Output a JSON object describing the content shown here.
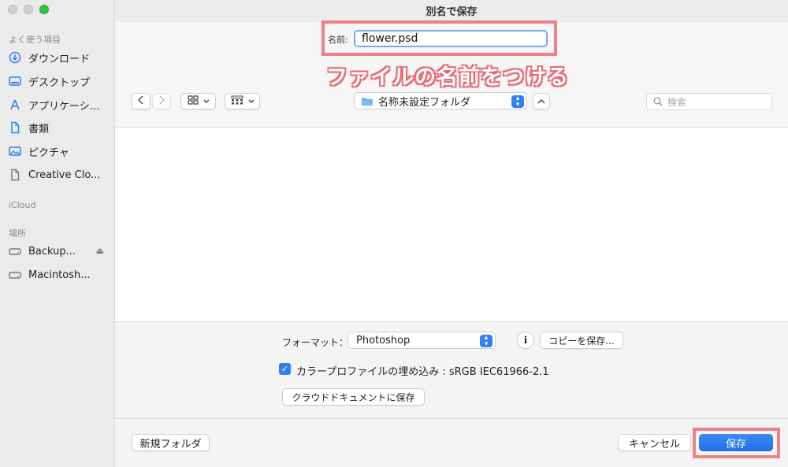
{
  "window": {
    "title": "別名で保存"
  },
  "sidebar": {
    "sections": {
      "favorites": "よく使う項目",
      "icloud": "iCloud",
      "locations": "場所"
    },
    "favorites": [
      {
        "label": "ダウンロード",
        "icon": "download-icon"
      },
      {
        "label": "デスクトップ",
        "icon": "desktop-icon"
      },
      {
        "label": "アプリケーシ…",
        "icon": "applications-icon"
      },
      {
        "label": "書類",
        "icon": "document-icon"
      },
      {
        "label": "ピクチャ",
        "icon": "pictures-icon"
      },
      {
        "label": "Creative Clo...",
        "icon": "file-icon"
      }
    ],
    "locations": [
      {
        "label": "Backup...",
        "icon": "drive-icon"
      },
      {
        "label": "Macintosh...",
        "icon": "drive-icon"
      }
    ]
  },
  "save": {
    "name_label": "名前:",
    "filename": "flower.psd",
    "annotation": "ファイルの名前をつける"
  },
  "toolbar": {
    "location": "名称未設定フォルダ",
    "search_placeholder": "検索"
  },
  "options": {
    "format_label": "フォーマット：",
    "format_value": "Photoshop",
    "info_icon": "i",
    "save_copy_label": "コピーを保存...",
    "embed_profile_label": "カラープロファイルの埋め込み : sRGB IEC61966-2.1",
    "embed_profile_checked": true,
    "cloud_doc_label": "クラウドドキュメントに保存"
  },
  "footer": {
    "new_folder_label": "新規フォルダ",
    "cancel_label": "キャンセル",
    "save_label": "保存"
  },
  "colors": {
    "accent": "#2f7ff5",
    "highlight": "#f07f87"
  }
}
